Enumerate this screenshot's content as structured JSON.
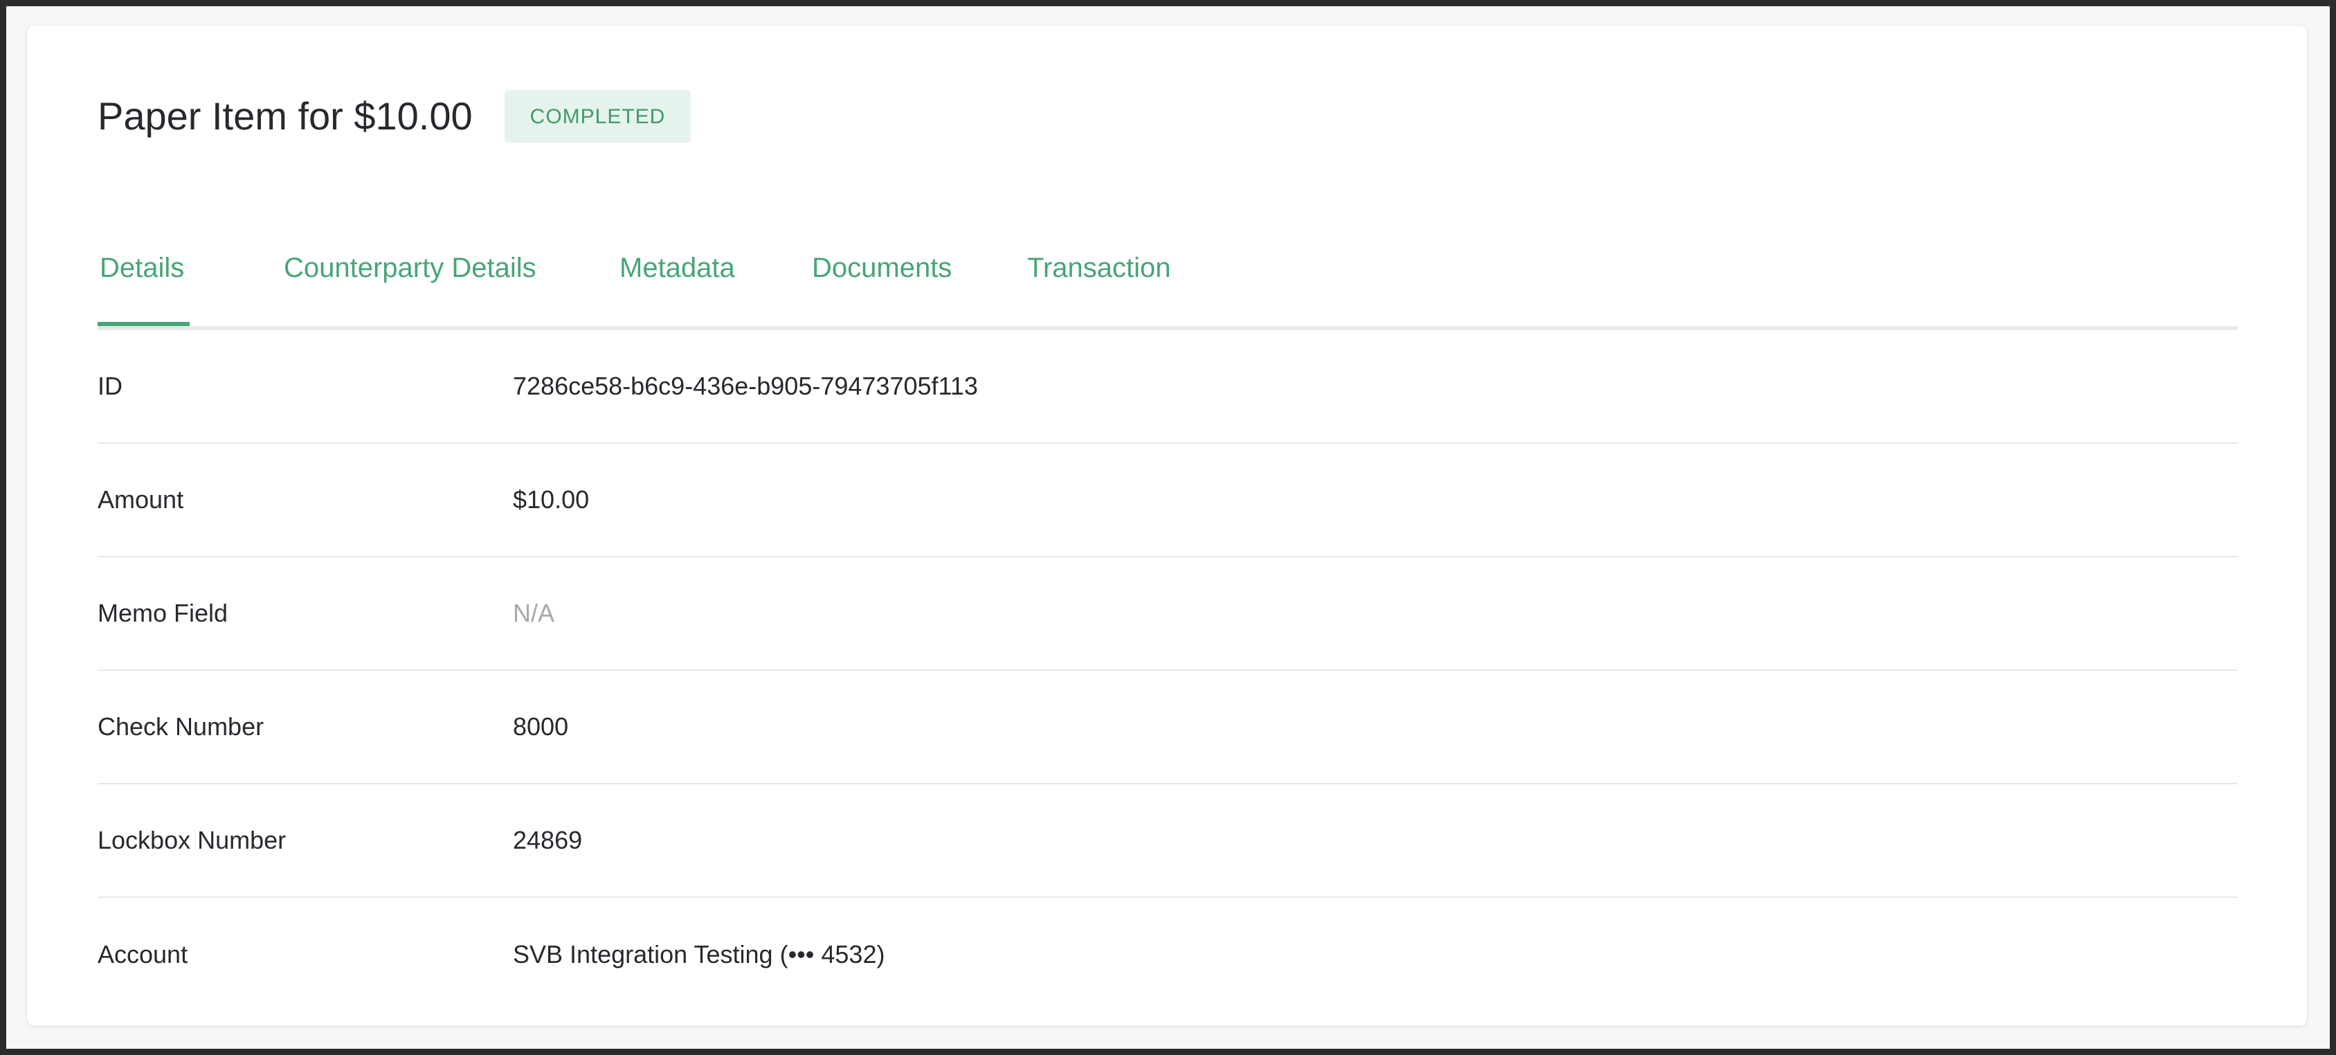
{
  "header": {
    "title": "Paper Item for $10.00",
    "status": "COMPLETED"
  },
  "tabs": [
    {
      "label": "Details",
      "active": true
    },
    {
      "label": "Counterparty Details",
      "active": false
    },
    {
      "label": "Metadata",
      "active": false
    },
    {
      "label": "Documents",
      "active": false
    },
    {
      "label": "Transaction",
      "active": false
    }
  ],
  "details": [
    {
      "label": "ID",
      "value": "7286ce58-b6c9-436e-b905-79473705f113"
    },
    {
      "label": "Amount",
      "value": "$10.00"
    },
    {
      "label": "Memo Field",
      "value": "N/A"
    },
    {
      "label": "Check Number",
      "value": "8000"
    },
    {
      "label": "Lockbox Number",
      "value": "24869"
    },
    {
      "label": "Account",
      "value": "SVB Integration Testing (••• 4532)"
    }
  ],
  "colors": {
    "accent": "#46a575",
    "badge_bg": "#e6f3ec",
    "muted_text": "#a4a8ad"
  }
}
